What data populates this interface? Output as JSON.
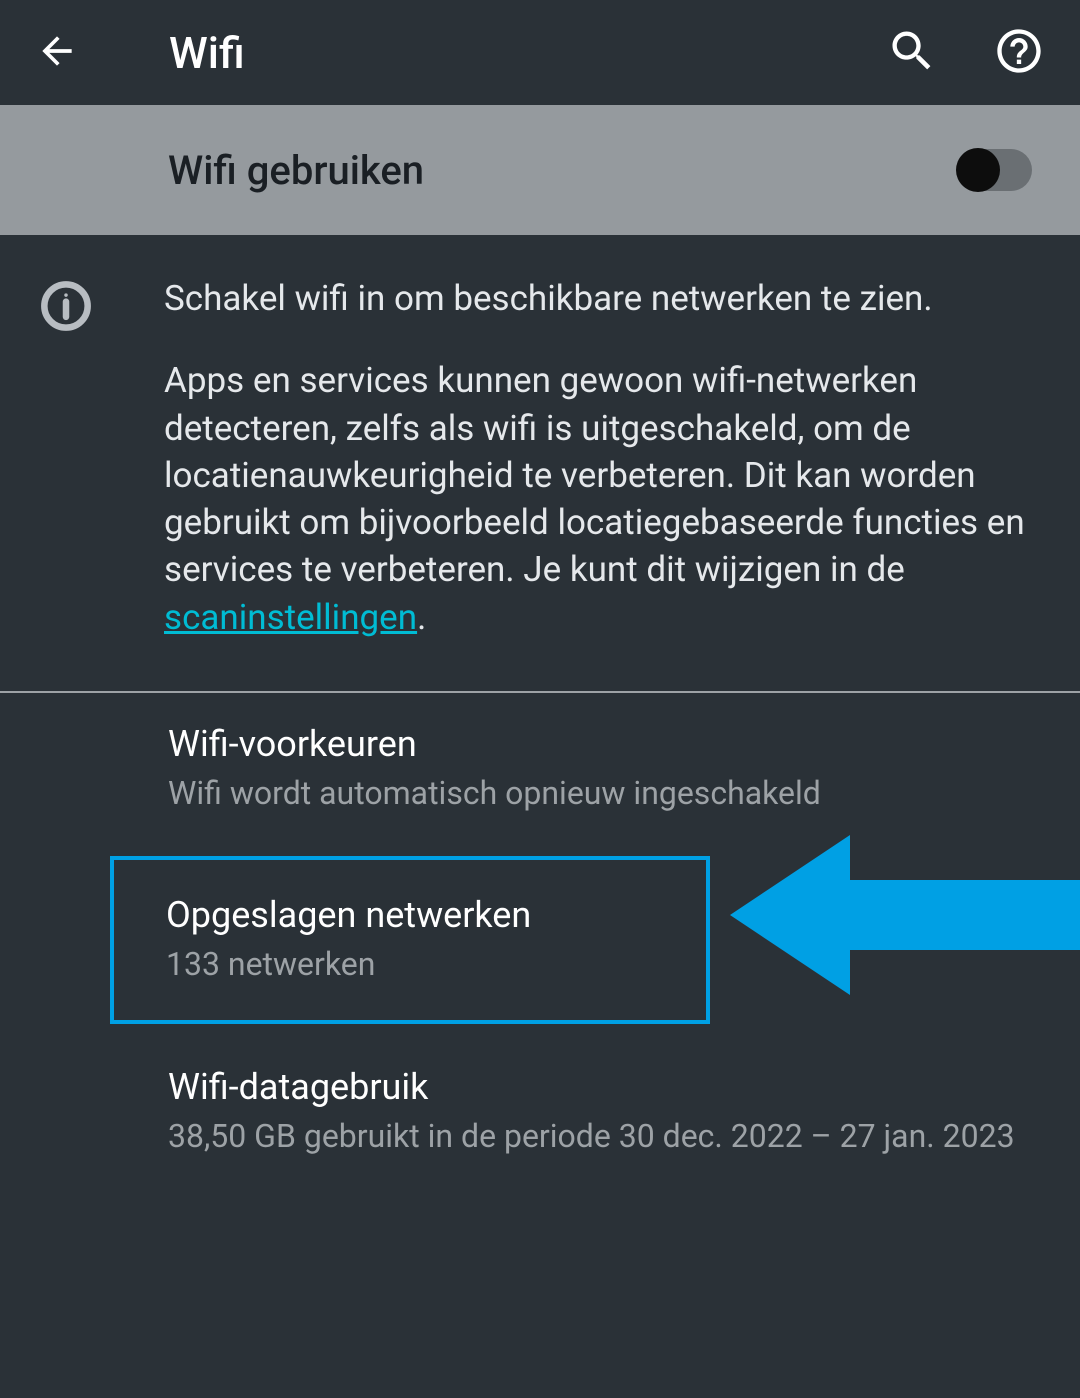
{
  "header": {
    "title": "Wifi"
  },
  "toggle": {
    "label": "Wifi gebruiken",
    "state": "off"
  },
  "info": {
    "line1": "Schakel wifi in om beschikbare netwerken te zien.",
    "line2": "Apps en services kunnen gewoon wifi-netwerken detecteren, zelfs als wifi is uitgeschakeld, om de locatienauwkeurigheid te verbeteren. Dit kan worden gebruikt om bijvoorbeeld locatiegebaseerde functies en services te verbeteren. Je kunt dit wijzigen in de ",
    "link_text": "scaninstellingen",
    "line2_end": "."
  },
  "settings": {
    "preferences": {
      "title": "Wifi-voorkeuren",
      "subtitle": "Wifi wordt automatisch opnieuw ingeschakeld"
    },
    "saved_networks": {
      "title": "Opgeslagen netwerken",
      "subtitle": "133 netwerken"
    },
    "data_usage": {
      "title": "Wifi-datagebruik",
      "subtitle": "38,50 GB gebruikt in de periode 30 dec. 2022 – 27 jan. 2023"
    }
  },
  "colors": {
    "highlight": "#00a0e4",
    "link": "#00bcd4"
  }
}
